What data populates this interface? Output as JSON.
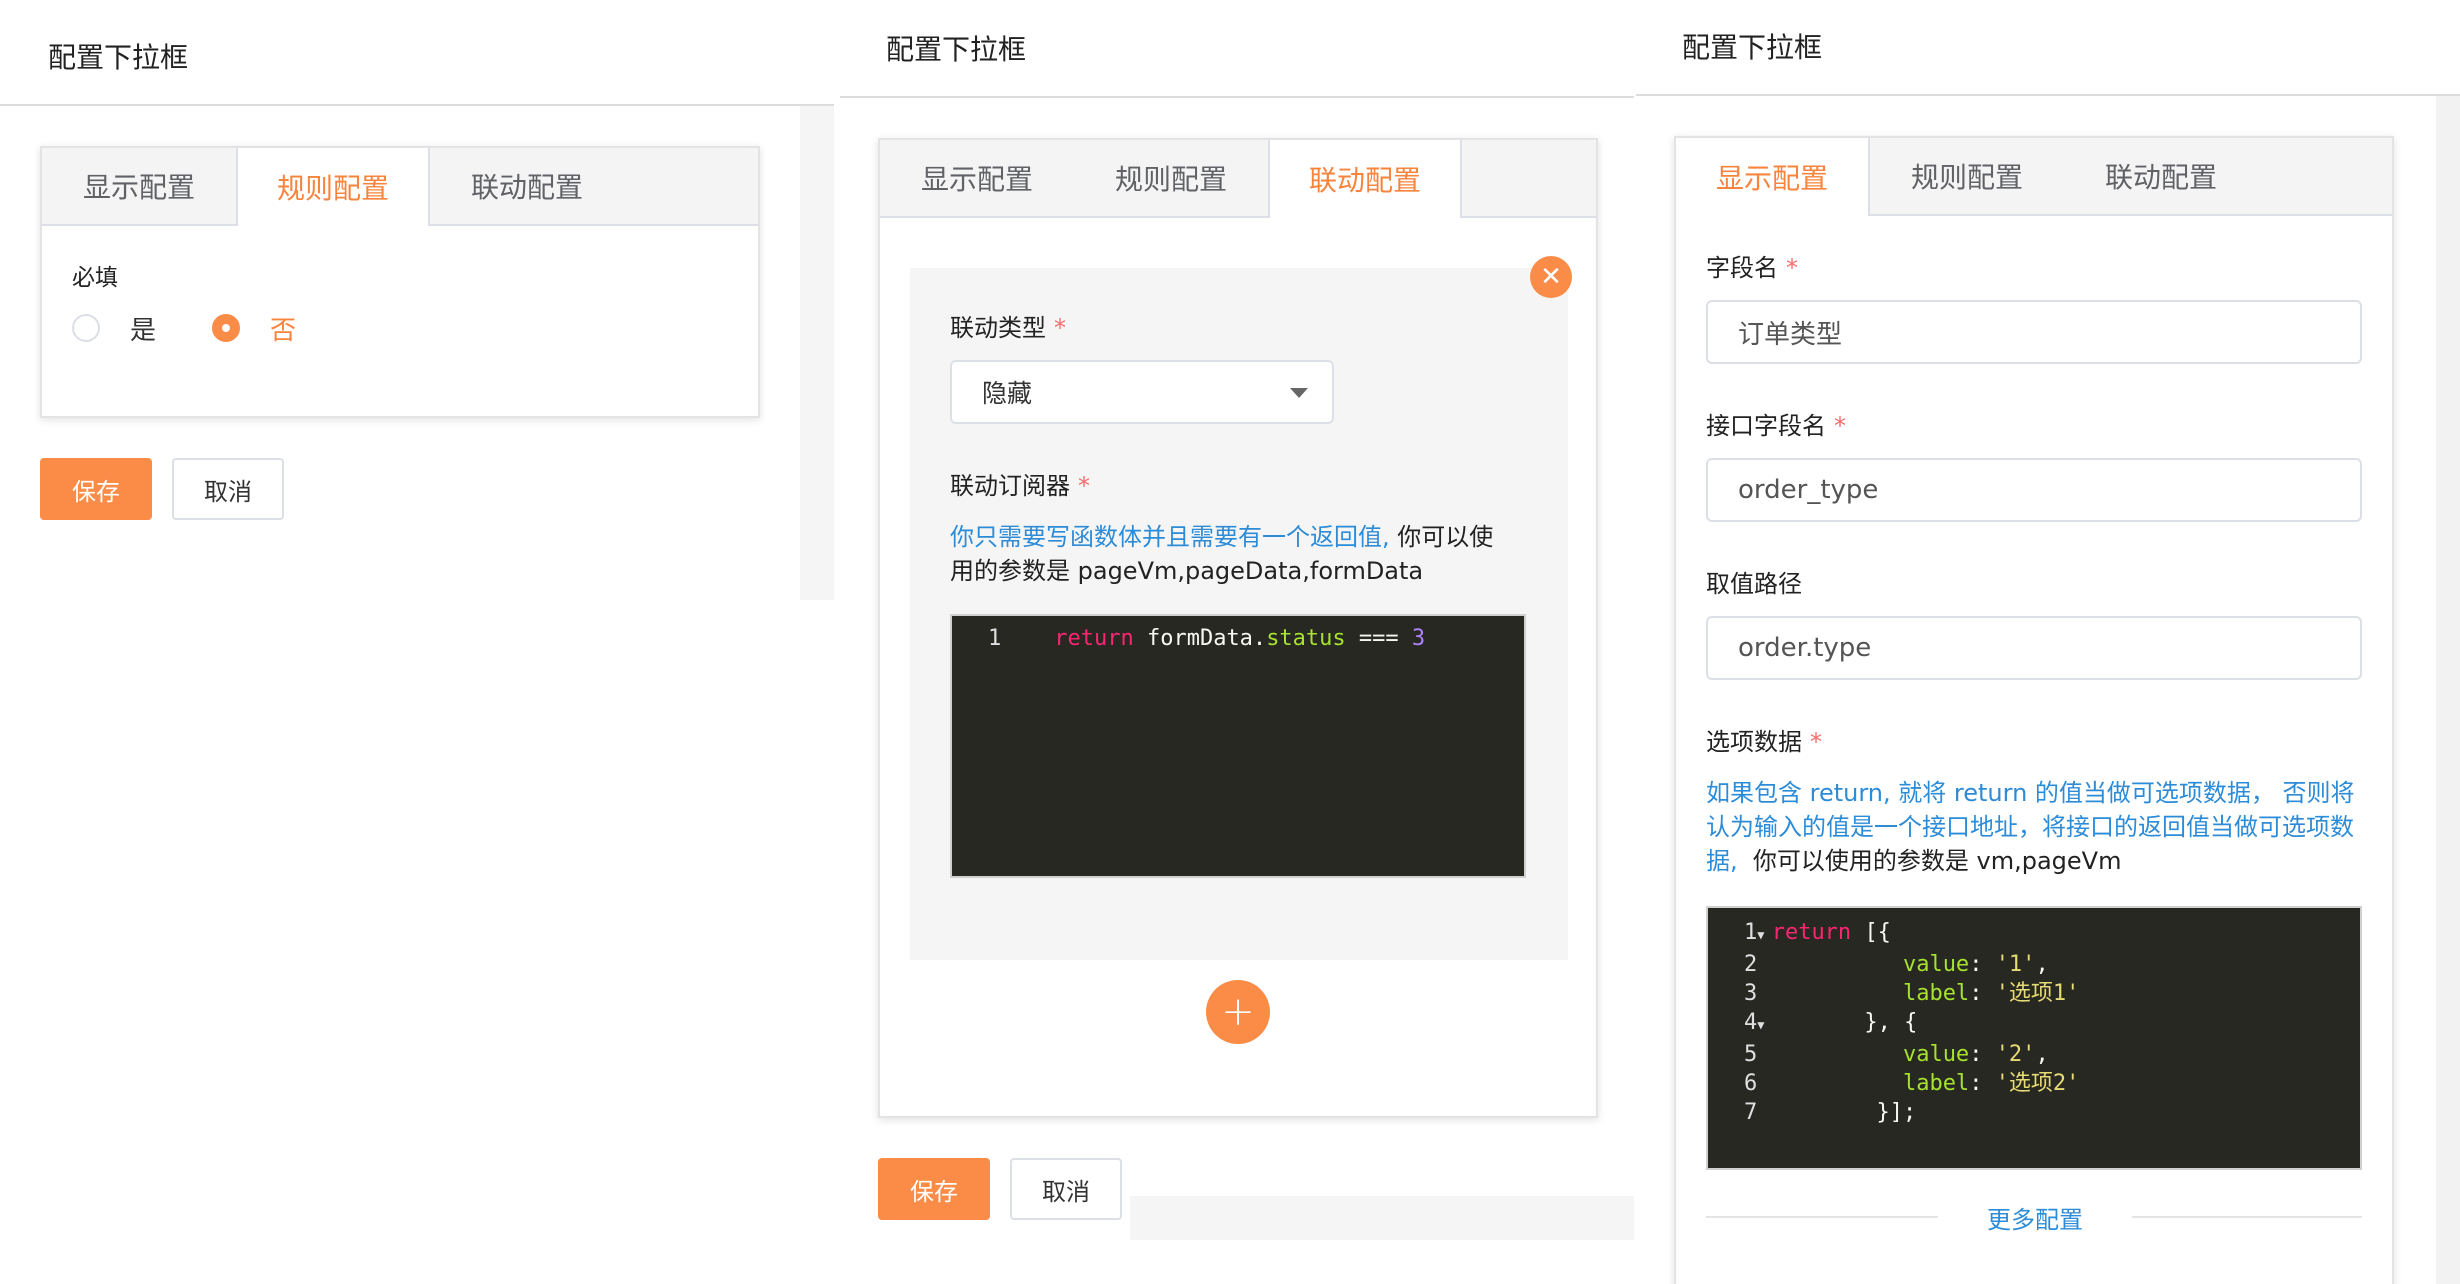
{
  "panel1": {
    "title": "配置下拉框",
    "tabs": [
      "显示配置",
      "规则配置",
      "联动配置"
    ],
    "active_tab": 1,
    "required_label": "必填",
    "radio_options": [
      {
        "label": "是",
        "checked": false
      },
      {
        "label": "否",
        "checked": true
      }
    ],
    "save_label": "保存",
    "cancel_label": "取消"
  },
  "panel2": {
    "title": "配置下拉框",
    "tabs": [
      "显示配置",
      "规则配置",
      "联动配置"
    ],
    "active_tab": 2,
    "link_type_label": "联动类型",
    "link_type_value": "隐藏",
    "subscriber_label": "联动订阅器",
    "hint_blue": "你只需要写函数体并且需要有一个返回值,",
    "hint_dark_1": "你可以使",
    "hint_dark_2": "用的参数是 pageVm,pageData,formData",
    "code_line_no": "1",
    "code_tokens": [
      "return",
      "formData.",
      "status",
      "===",
      "3"
    ],
    "save_label": "保存",
    "cancel_label": "取消",
    "required_mark": "*"
  },
  "panel3": {
    "title": "配置下拉框",
    "tabs": [
      "显示配置",
      "规则配置",
      "联动配置"
    ],
    "active_tab": 0,
    "field_name_label": "字段名",
    "field_name_value": "订单类型",
    "api_field_label": "接口字段名",
    "api_field_value": "order_type",
    "value_path_label": "取值路径",
    "value_path_value": "order.type",
    "options_label": "选项数据",
    "hint_blue_1": "如果包含 return, 就将 return 的值当做可选项数据， 否则将",
    "hint_blue_2": "认为输入的值是一个接口地址，将接口的返回值当做可选项数",
    "hint_blue_3": "据,",
    "hint_dark_3": "你可以使用的参数是 vm,pageVm",
    "code_lines": [
      {
        "n": "1",
        "fold": true
      },
      {
        "n": "2",
        "fold": false
      },
      {
        "n": "3",
        "fold": false
      },
      {
        "n": "4",
        "fold": true
      },
      {
        "n": "5",
        "fold": false
      },
      {
        "n": "6",
        "fold": false
      },
      {
        "n": "7",
        "fold": false
      }
    ],
    "code_text": {
      "l1_kw": "return",
      "l1_rest": "[{",
      "l2_key": "value",
      "l2_val": "'1'",
      "l3_key": "label",
      "l3_val": "'选项1'",
      "l4": "}, {",
      "l5_key": "value",
      "l5_val": "'2'",
      "l6_key": "label",
      "l6_val": "'选项2'",
      "l7": "}];"
    },
    "more_config_label": "更多配置"
  },
  "colors": {
    "accent": "#fa8c48",
    "active_tab_text": "#f8843e",
    "hint_blue": "#2d8cd8",
    "required": "#f56c6c",
    "code_bg": "#272822"
  },
  "icons": {
    "close": "close-circle-icon",
    "add": "plus-circle-icon",
    "dropdown": "caret-down-icon"
  }
}
